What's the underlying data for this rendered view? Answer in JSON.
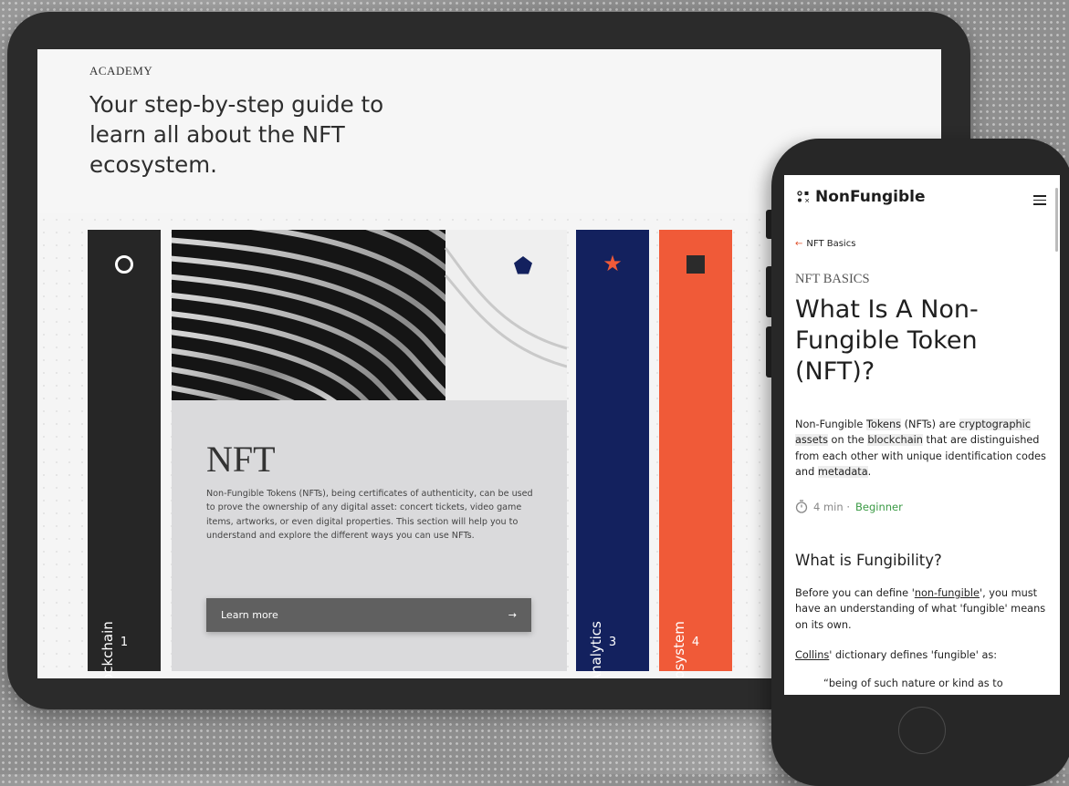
{
  "tablet": {
    "eyebrow": "ACADEMY",
    "hero_title": "Your step-by-step guide to learn all about the NFT ecosystem.",
    "bars": [
      {
        "label": "Blockchain",
        "number": "1",
        "icon": "circle-icon",
        "color": "#262626"
      },
      {
        "label": "Analytics",
        "number": "3",
        "icon": "star-icon",
        "color": "#13215e"
      },
      {
        "label": "Ecosystem",
        "number": "4",
        "icon": "square-icon",
        "color": "#f05a38"
      }
    ],
    "card": {
      "title": "NFT",
      "description": "Non-Fungible Tokens (NFTs), being certificates of authenticity, can be used to prove the ownership of any digital asset: concert tickets, video game items, artworks, or even digital properties. This section will help you to understand and explore the different ways you can use NFTs.",
      "button_label": "Learn more",
      "button_arrow": "→",
      "icon": "pentagon-icon"
    }
  },
  "phone": {
    "brand": "NonFungible",
    "back_link": "NFT Basics",
    "back_arrow": "←",
    "category": "NFT BASICS",
    "title": "What Is A Non-Fungible Token (NFT)?",
    "intro": {
      "t1": "Non-Fungible ",
      "t2": "Tokens",
      "t3": " (NFTs) are ",
      "t4": "cryptographic assets",
      "t5": " on the ",
      "t6": "blockchain",
      "t7": " that are distinguished from each other with unique identification codes and ",
      "t8": "metadata",
      "t9": "."
    },
    "meta": {
      "duration": "4 min ·",
      "level": "Beginner"
    },
    "section_heading": "What is Fungibility?",
    "p1": {
      "before": "Before you can define '",
      "link": "non-fungible",
      "after": "', you must have an understanding of what 'fungible' means on its own."
    },
    "p2": {
      "link": "Collins",
      "after": "' dictionary defines 'fungible' as:"
    },
    "quote": "“being of such nature or kind as to"
  }
}
